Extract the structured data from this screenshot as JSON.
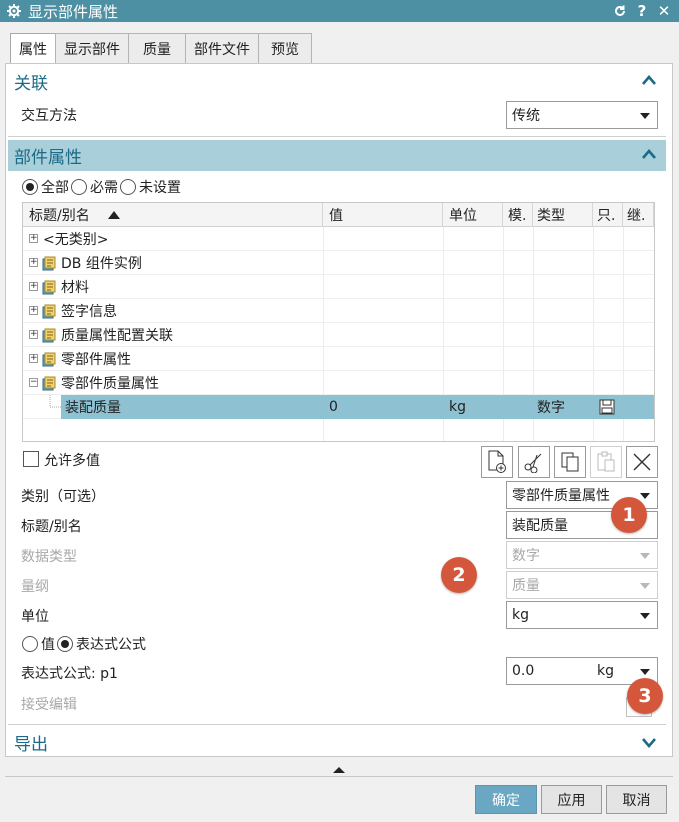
{
  "window": {
    "title": "显示部件属性",
    "icon": "gear-icon",
    "buttons": [
      "refresh-icon",
      "help-icon",
      "close-icon"
    ]
  },
  "tabs": [
    {
      "label": "属性",
      "active": true
    },
    {
      "label": "显示部件",
      "active": false
    },
    {
      "label": "质量",
      "active": false
    },
    {
      "label": "部件文件",
      "active": false
    },
    {
      "label": "预览",
      "active": false
    }
  ],
  "relation": {
    "header": "关联",
    "interaction_label": "交互方法",
    "interaction_value": "传统"
  },
  "part_attributes": {
    "header": "部件属性",
    "filters": [
      {
        "label": "全部",
        "selected": true
      },
      {
        "label": "必需",
        "selected": false
      },
      {
        "label": "未设置",
        "selected": false
      }
    ],
    "columns": [
      "标题/别名",
      "值",
      "单位",
      "模.",
      "类型",
      "只.",
      "继."
    ],
    "rows": [
      {
        "label": "<无类别>",
        "has_icon": false,
        "expander": "+"
      },
      {
        "label": "DB 组件实例",
        "has_icon": true,
        "expander": "+"
      },
      {
        "label": "材料",
        "has_icon": true,
        "expander": "+"
      },
      {
        "label": "签字信息",
        "has_icon": true,
        "expander": "+"
      },
      {
        "label": "质量属性配置关联",
        "has_icon": true,
        "expander": "+"
      },
      {
        "label": "零部件属性",
        "has_icon": true,
        "expander": "+"
      },
      {
        "label": "零部件质量属性",
        "has_icon": true,
        "expander": "-"
      }
    ],
    "selected_row": {
      "label": "装配质量",
      "value": "0",
      "unit": "kg",
      "type": "数字"
    },
    "allow_multi_label": "允许多值"
  },
  "form": {
    "category_label": "类别（可选）",
    "category_value": "零部件质量属性",
    "title_label": "标题/别名",
    "title_value": "装配质量",
    "datatype_label": "数据类型",
    "datatype_value": "数字",
    "dimension_label": "量纲",
    "dimension_value": "质量",
    "unit_label": "单位",
    "unit_value": "kg",
    "value_mode": [
      {
        "label": "值",
        "selected": false
      },
      {
        "label": "表达式公式",
        "selected": true
      }
    ],
    "expression_label": "表达式公式: p1",
    "expression_value": "0.0",
    "expression_unit": "kg",
    "accept_edit_label": "接受编辑"
  },
  "export": {
    "header": "导出"
  },
  "badges": [
    "1",
    "2",
    "3"
  ],
  "footer": {
    "ok": "确定",
    "apply": "应用",
    "cancel": "取消"
  },
  "colors": {
    "titlebar": "#4d8fa3",
    "section": "#a9cfdb",
    "accent_text": "#1b6a86",
    "selected_row": "#8ec1d2",
    "badge": "#d5573b",
    "primary_button": "#6aa7c2"
  }
}
